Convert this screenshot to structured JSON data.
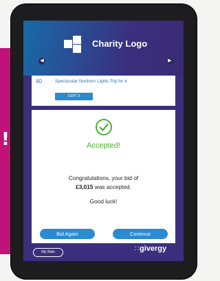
{
  "header": {
    "logo_text": "Charity Logo"
  },
  "item": {
    "lot_number": "40",
    "title": "Spectacular Northern Lights Trip for 4",
    "button_label": "EDIT 3"
  },
  "confirmation": {
    "status": "Accepted!",
    "message_line1": "Congratulations, your bid of",
    "bid_amount": "£3,015",
    "message_line2": "was accepted.",
    "closing": "Good luck!",
    "bid_again_label": "Bid Again",
    "continue_label": "Continue"
  },
  "footer": {
    "my_bids_label": "My Bids",
    "brand": "givergy"
  },
  "colors": {
    "accent": "#2b8bd0",
    "success": "#4caf35",
    "screen_bg": "#3b2f7d",
    "pink": "#c1127a"
  }
}
